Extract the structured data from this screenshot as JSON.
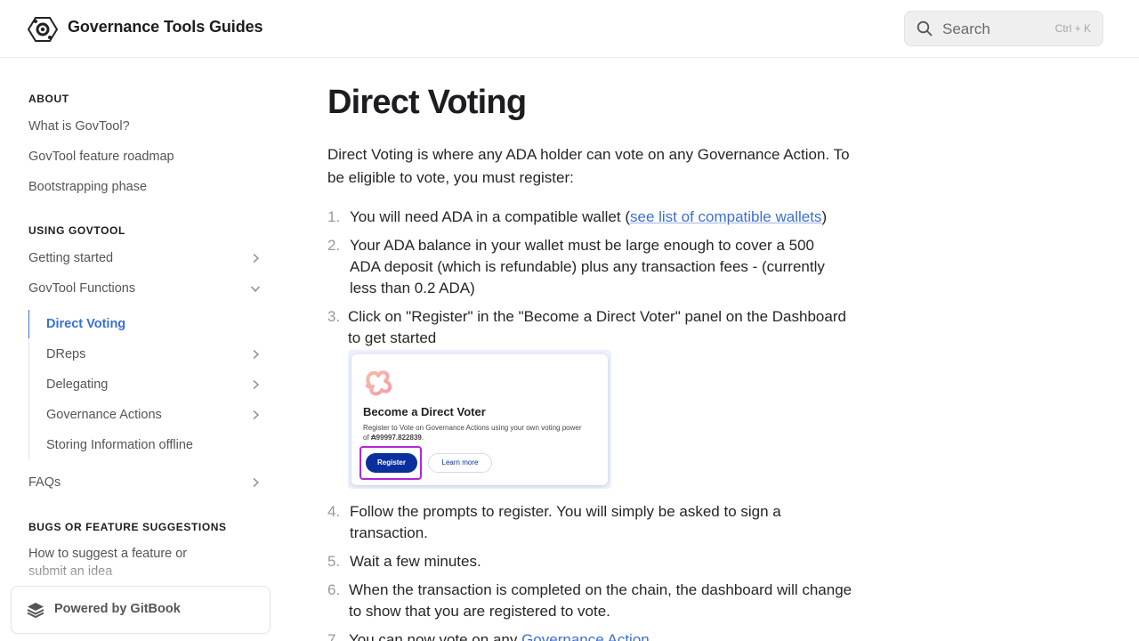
{
  "header": {
    "site_title": "Governance Tools Guides",
    "search": {
      "label": "Search",
      "shortcut": "Ctrl + K"
    }
  },
  "sidebar": {
    "sections": [
      {
        "title": "ABOUT"
      },
      {
        "title": "USING GOVTOOL"
      },
      {
        "title": "BUGS OR FEATURE SUGGESTIONS"
      }
    ],
    "items": [
      {
        "label": "What is GovTool?"
      },
      {
        "label": "GovTool feature roadmap"
      },
      {
        "label": "Bootstrapping phase"
      },
      {
        "label": "Getting started"
      },
      {
        "label": "GovTool Functions"
      },
      {
        "label": "Direct Voting"
      },
      {
        "label": "DReps"
      },
      {
        "label": "Delegating"
      },
      {
        "label": "Governance Actions"
      },
      {
        "label": "Storing Information offline"
      },
      {
        "label": "FAQs"
      },
      {
        "label": "How to suggest a feature or submit an idea"
      }
    ],
    "powered_by": "Powered by GitBook"
  },
  "main": {
    "title": "Direct Voting",
    "intro": "Direct Voting is where any ADA holder can vote on any Governance Action. To be eligible to vote, you must register:",
    "steps": [
      {
        "num": "1.",
        "before": "You will need ADA in a compatible wallet (",
        "link": "see list of compatible wallets",
        "after": ")"
      },
      {
        "num": "2.",
        "text": "Your ADA balance in your wallet must be large enough to cover a 500 ADA deposit (which is refundable) plus any transaction fees - (currently less than 0.2 ADA)"
      },
      {
        "num": "3.",
        "text": "Click on \"Register\" in the \"Become a Direct Voter\" panel on the Dashboard to get started"
      },
      {
        "num": "4.",
        "text": "Follow the prompts to register. You will simply be asked to sign a transaction."
      },
      {
        "num": "5.",
        "text": "Wait a few minutes."
      },
      {
        "num": "6.",
        "text": "When the transaction is completed on the chain, the dashboard will change to show that you are registered to vote."
      },
      {
        "num": "7.",
        "before": "You can now vote on any ",
        "link": "Governance Action",
        "after": ""
      }
    ],
    "screenshot": {
      "title": "Become a Direct Voter",
      "desc_line1": "Register to Vote on Governance Actions using your own voting power",
      "desc_of": "of ",
      "desc_amount": "₳99997.822839",
      "desc_end": ".",
      "register": "Register",
      "learn_more": "Learn more"
    }
  },
  "colors": {
    "accent": "#3a6fd6",
    "register_button": "#0b2f9f",
    "highlight": "#b026d6"
  }
}
